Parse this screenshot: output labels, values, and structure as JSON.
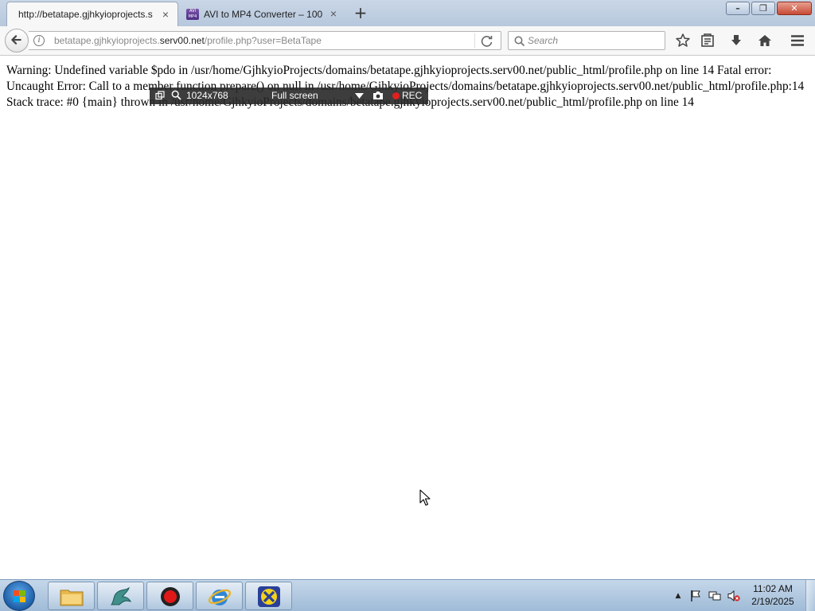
{
  "browser": {
    "tabs": [
      {
        "label": "http://betatape.gjhkyioprojects.s",
        "active": true
      },
      {
        "label": "AVI to MP4 Converter – 100",
        "active": false
      }
    ],
    "new_tab_label": "+",
    "close_tab_glyph": "×",
    "window_buttons": {
      "minimize": "–",
      "maximize": "❐",
      "close": "✕"
    },
    "address": {
      "prefix": "betatape.gjhkyioprojects.",
      "host": "serv00.net",
      "path": "/profile.php?user=BetaTape"
    },
    "search": {
      "placeholder": "Search"
    },
    "toolbar_icons": [
      "bookmark-star-icon",
      "reading-list-icon",
      "download-icon",
      "home-icon",
      "menu-icon"
    ]
  },
  "page": {
    "error_text": "Warning: Undefined variable $pdo in /usr/home/GjhkyioProjects/domains/betatape.gjhkyioprojects.serv00.net/public_html/profile.php on line 14 Fatal error: Uncaught Error: Call to a member function prepare() on null in /usr/home/GjhkyioProjects/domains/betatape.gjhkyioprojects.serv00.net/public_html/profile.php:14 Stack trace: #0 {main} thrown in /usr/home/GjhkyioProjects/domains/betatape.gjhkyioprojects.serv00.net/public_html/profile.php on line 14"
  },
  "recorder": {
    "resolution": "1024x768",
    "mode": "Full screen",
    "rec_label": "REC"
  },
  "taskbar": {
    "items": [
      "file-explorer",
      "bash-dragon",
      "record-app",
      "internet-explorer",
      "x-app"
    ],
    "clock": {
      "time": "11:02 AM",
      "date": "2/19/2025"
    }
  }
}
